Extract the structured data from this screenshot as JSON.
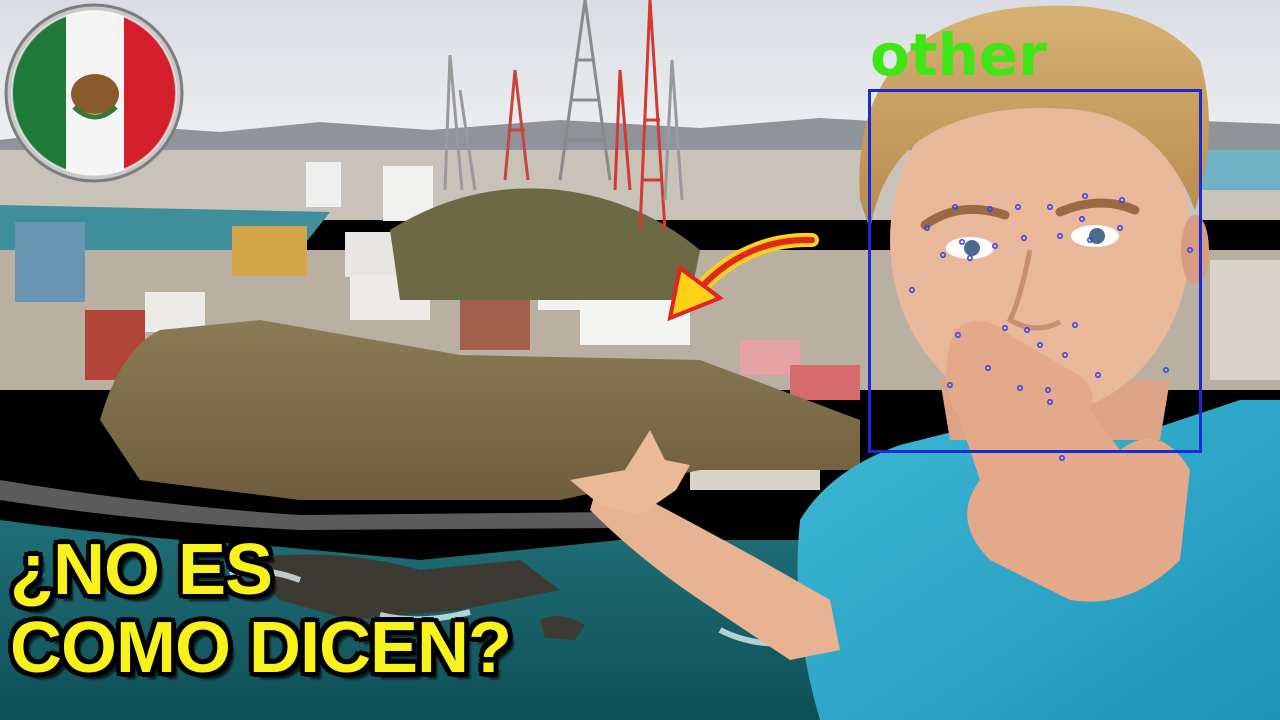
{
  "overlay": {
    "label": "other",
    "label_color": "#3ee616",
    "box_color": "#1a2bd6",
    "landmark_color": "#2f3ff0"
  },
  "caption": {
    "line1": "¿NO ES",
    "line2": "COMO DICEN?",
    "color": "#f7f21c"
  },
  "flag": {
    "green": "#1f7a3a",
    "white": "#f5f5f5",
    "red": "#d21f2b"
  },
  "icons": {
    "arrow": "curved-arrow-icon",
    "flag": "mexico-flag-icon"
  }
}
